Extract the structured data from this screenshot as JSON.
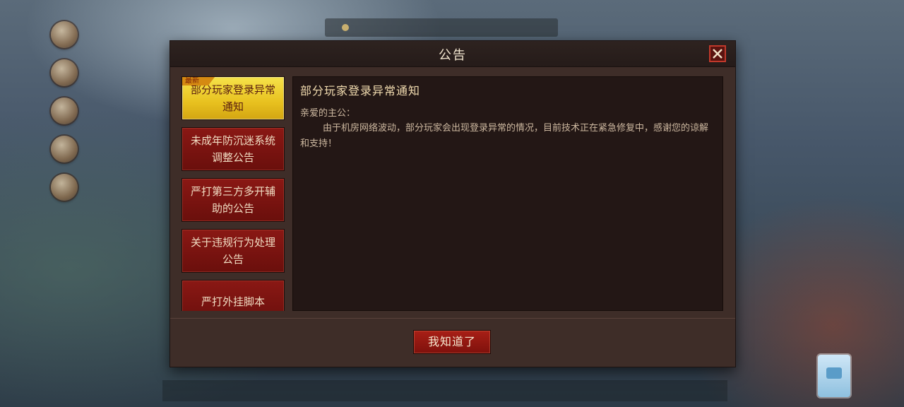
{
  "dialog": {
    "title": "公告",
    "confirm_label": "我知道了"
  },
  "notices": [
    {
      "label": "部分玩家登录异常通知",
      "badge": "最新",
      "active": true
    },
    {
      "label": "未成年防沉迷系统调整公告",
      "active": false
    },
    {
      "label": "严打第三方多开辅助的公告",
      "active": false
    },
    {
      "label": "关于违规行为处理公告",
      "active": false
    },
    {
      "label": "严打外挂脚本",
      "active": false
    }
  ],
  "content": {
    "title": "部分玩家登录异常通知",
    "greeting": "亲爱的主公：",
    "body": "由于机房网络波动，部分玩家会出现登录异常的情况，目前技术正在紧急修复中，感谢您的谅解和支持！"
  },
  "colors": {
    "dialog_bg": "#3e2d28",
    "active_item": "#e8c11f",
    "item_red": "#7e110c",
    "close_border": "#c0392b"
  },
  "icons": {
    "close": "close-icon"
  }
}
